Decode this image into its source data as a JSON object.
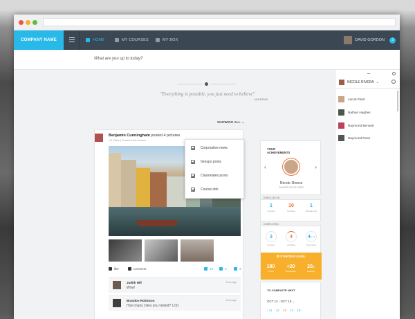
{
  "nav": {
    "brand": "COMPANY NAME",
    "home": "HOME",
    "my_courses": "MY COURSES",
    "my_box": "MY BOX",
    "user": "DAVID GORDON",
    "badge": "3"
  },
  "status": {
    "placeholder": "What are you up to today?"
  },
  "quote": {
    "text": "\"Everything is possible, you just need to believe\"",
    "author": "- ANDREWS"
  },
  "filter": {
    "label": "SHOWING ALL",
    "options": [
      "Corporative news",
      "Groups posts",
      "Classmates posts",
      "Course info"
    ]
  },
  "post": {
    "author": "Benjamin Cunningham",
    "action": "posted 4 pictures",
    "meta": "UX Class | Posted in all courses",
    "like": "like",
    "comment": "comment",
    "likes": "12",
    "comments": "2",
    "shares": "3"
  },
  "comments": [
    {
      "name": "Judith Hill",
      "text": "Wow!",
      "date": "2min ago"
    },
    {
      "name": "Brandon Robinson",
      "text": "How many cities you visited? LOL!",
      "date": "2min ago"
    }
  ],
  "achievements": {
    "title_line1": "YOUR",
    "title_line2": "ACHIEVEMENTS",
    "name": "Nicole Rivera",
    "role": "JUNIOR DEVELOPER",
    "enrolled_label": "ENROLLED IN",
    "enrolled": [
      {
        "value": "1",
        "label": "Courses",
        "color": "#29b9e8"
      },
      {
        "value": "10",
        "label": "Activities",
        "color": "#f26d2b"
      },
      {
        "value": "1",
        "label": "Workgroups",
        "color": "#29b9e8"
      }
    ],
    "completed_label": "COMPLETED",
    "completed": [
      {
        "value": "3",
        "label": "Lessons",
        "color": "#29b9e8"
      },
      {
        "value": "4",
        "label": "Activities",
        "color": "#f26d2b"
      },
      {
        "value": "4",
        "suffix": "of 15",
        "label": "Time spent",
        "color": "#29b9e8"
      }
    ],
    "level": "STARTER LEVEL",
    "level_stats": [
      {
        "value": "180",
        "label": "Points"
      },
      {
        "value": "+20",
        "label": "Reputation"
      },
      {
        "value": "20",
        "suffix": "th",
        "label": "Ranking"
      }
    ]
  },
  "todo": {
    "title": "TO COMPLETE NEXT",
    "range": "OCT 13 - OCT 19",
    "days": [
      "11",
      "12",
      "13",
      "14",
      "15"
    ]
  },
  "sidebar": {
    "me": "NICOLE RIVERA",
    "friends": [
      {
        "name": "Jacob Patel",
        "color": "#c9a58a"
      },
      {
        "name": "Nathan Hughes",
        "color": "#4a5a4a"
      },
      {
        "name": "Raymond Bennett",
        "color": "#c0405a"
      },
      {
        "name": "Raymond Rose",
        "color": "#555555"
      }
    ]
  },
  "colors": {
    "accent": "#29b9e8",
    "orange": "#f26d2b",
    "level": "#f8b02c",
    "nav_bg": "#3b4854"
  }
}
